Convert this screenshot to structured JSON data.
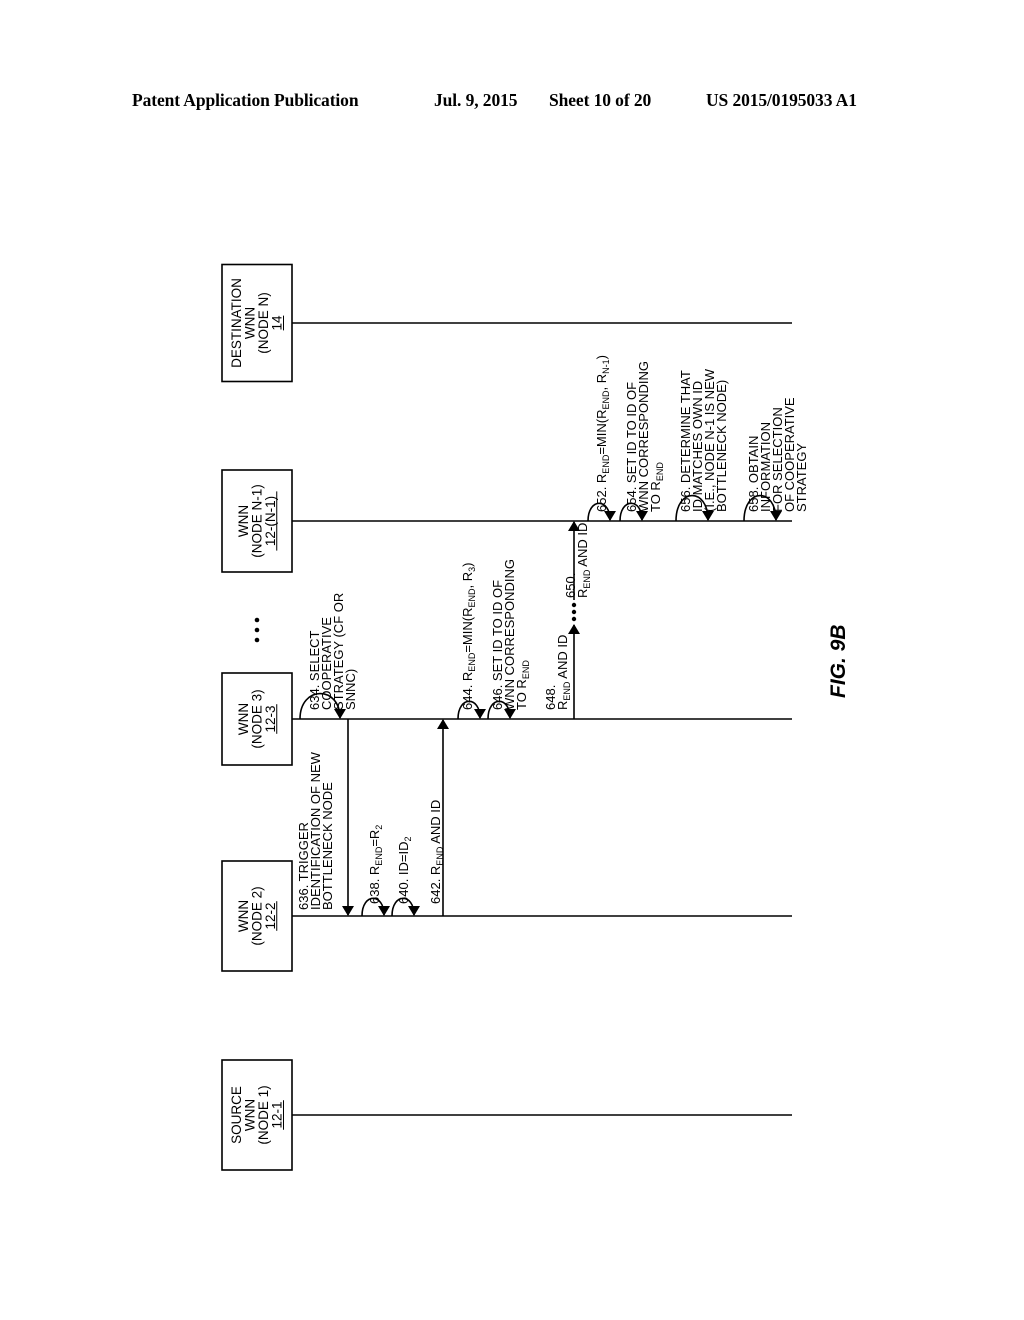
{
  "header": {
    "publication": "Patent Application Publication",
    "date": "Jul. 9, 2015",
    "sheet": "Sheet 10 of 20",
    "number": "US 2015/0195033 A1"
  },
  "figure": {
    "label": "FIG. 9B",
    "nodes": [
      {
        "id": "source",
        "lines": [
          "SOURCE",
          "WNN",
          "(NODE 1)"
        ],
        "ref": "12-1"
      },
      {
        "id": "node2",
        "lines": [
          "WNN",
          "(NODE 2)"
        ],
        "ref": "12-2"
      },
      {
        "id": "node3",
        "lines": [
          "WNN",
          "(NODE 3)"
        ],
        "ref": "12-3"
      },
      {
        "id": "nodeN-1",
        "lines": [
          "WNN",
          "(NODE N-1)"
        ],
        "ref": "12-(N-1)"
      },
      {
        "id": "destination",
        "lines": [
          "DESTINATION",
          "WNN",
          "(NODE N)"
        ],
        "ref": "14"
      }
    ],
    "ellipsis_between": [
      "node3",
      "nodeN-1"
    ],
    "steps": [
      {
        "num": "634",
        "type": "self",
        "node": "node3",
        "lines": [
          "634. SELECT",
          "COOPERATIVE",
          "STRATEGY (CF OR",
          "SNNC)"
        ]
      },
      {
        "num": "636",
        "type": "message",
        "from": "node3",
        "to": "node2",
        "lines": [
          "636. TRIGGER",
          "IDENTIFICATION OF NEW",
          "BOTTLENECK NODE"
        ]
      },
      {
        "num": "638",
        "type": "self",
        "node": "node2",
        "lines": [
          "638. R{END}=R{2}"
        ]
      },
      {
        "num": "640",
        "type": "self",
        "node": "node2",
        "lines": [
          "640. ID=ID{2}"
        ]
      },
      {
        "num": "642",
        "type": "message",
        "from": "node2",
        "to": "node3",
        "lines": [
          "642. R{END} AND ID"
        ]
      },
      {
        "num": "644",
        "type": "self",
        "node": "node3",
        "lines": [
          "644. R{END}=MIN(R{END}, R{3})"
        ]
      },
      {
        "num": "646",
        "type": "self",
        "node": "node3",
        "lines": [
          "646. SET ID TO ID OF",
          "WNN CORRESPONDING",
          "TO R{END}"
        ]
      },
      {
        "num": "648",
        "type": "message",
        "from": "node3",
        "to": "ellipsis",
        "lines": [
          "648.",
          "R{END} AND ID"
        ]
      },
      {
        "num": "650",
        "type": "message",
        "from": "ellipsis",
        "to": "nodeN-1",
        "lines": [
          "650.",
          "R{END} AND ID"
        ]
      },
      {
        "num": "652",
        "type": "self",
        "node": "nodeN-1",
        "lines": [
          "652. R{END}=MIN(R{END}, R{N-1})"
        ]
      },
      {
        "num": "654",
        "type": "self",
        "node": "nodeN-1",
        "lines": [
          "654. SET ID TO ID OF",
          "WNN CORRESPONDING",
          "TO R{END}"
        ]
      },
      {
        "num": "656",
        "type": "self",
        "node": "nodeN-1",
        "lines": [
          "656. DETERMINE THAT",
          "ID MATCHES OWN ID",
          "(I.E., NODE N-1 IS NEW",
          "BOTTLENECK NODE)"
        ]
      },
      {
        "num": "658",
        "type": "self",
        "node": "nodeN-1",
        "lines": [
          "658. OBTAIN",
          "INFORMATION",
          "FOR SELECTION",
          "OF COOPERATIVE",
          "STRATEGY"
        ]
      }
    ]
  },
  "colors": {
    "ink": "#000000",
    "paper": "#ffffff"
  }
}
